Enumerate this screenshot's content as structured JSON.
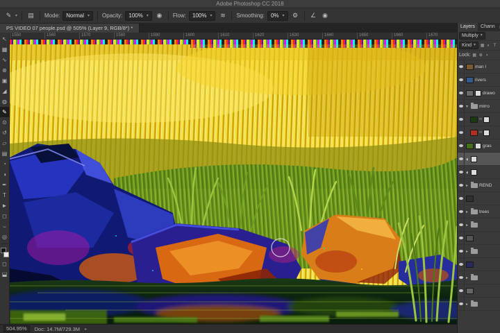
{
  "app": {
    "title": "Adobe Photoshop CC 2018"
  },
  "icons": {
    "chevron_down": "▾",
    "gear": "⚙",
    "pressure": "◉",
    "airbrush": "≋",
    "brush_preset": "✎",
    "brush_panel": "▤",
    "angle": "∠",
    "folder_arrow_open": "▾",
    "folder_arrow_closed": "▸",
    "link": "∞",
    "panel_menu": "»",
    "popup_arrow": "▸"
  },
  "options_bar": {
    "mode_label": "Mode:",
    "mode_value": "Normal",
    "opacity_label": "Opacity:",
    "opacity_value": "100%",
    "flow_label": "Flow:",
    "flow_value": "100%",
    "smoothing_label": "Smoothing:",
    "smoothing_value": "0%"
  },
  "document_tab": {
    "title": "PS VIDEO 07 people.psd @ 505% (Layer 9, RGB/8*) *"
  },
  "ruler": {
    "ticks": [
      "1550",
      "1560",
      "1570",
      "1580",
      "1590",
      "1600",
      "1610",
      "1620",
      "1630",
      "1640",
      "1650",
      "1660",
      "1670"
    ]
  },
  "toolbar": {
    "tools": [
      {
        "name": "move",
        "glyph": "↖"
      },
      {
        "name": "marquee",
        "glyph": "▦"
      },
      {
        "name": "lasso",
        "glyph": "∿"
      },
      {
        "name": "quick-selection",
        "glyph": "⊛"
      },
      {
        "name": "crop",
        "glyph": "▣"
      },
      {
        "name": "eyedropper",
        "glyph": "◢"
      },
      {
        "name": "spot-healing",
        "glyph": "◍"
      },
      {
        "name": "brush",
        "glyph": "✎"
      },
      {
        "name": "clone-stamp",
        "glyph": "⊙"
      },
      {
        "name": "history-brush",
        "glyph": "↺"
      },
      {
        "name": "eraser",
        "glyph": "▱"
      },
      {
        "name": "gradient",
        "glyph": "▤"
      },
      {
        "name": "blur",
        "glyph": "◔"
      },
      {
        "name": "dodge",
        "glyph": "◑"
      },
      {
        "name": "pen",
        "glyph": "✒"
      },
      {
        "name": "type",
        "glyph": "T"
      },
      {
        "name": "path-selection",
        "glyph": "►"
      },
      {
        "name": "shape",
        "glyph": "◻"
      },
      {
        "name": "hand",
        "glyph": "⌣"
      },
      {
        "name": "zoom",
        "glyph": "◎"
      }
    ]
  },
  "layers_panel": {
    "tabs": [
      {
        "label": "Layers"
      },
      {
        "label": "Chann"
      }
    ],
    "blend_mode": "Multiply",
    "filter_label": "Kind",
    "lock_label": "Lock:",
    "layers": [
      {
        "name": "man l"
      },
      {
        "name": "rivers"
      },
      {
        "name": "drawo"
      },
      {
        "name": "mirro"
      },
      {
        "name": ""
      },
      {
        "name": ""
      },
      {
        "name": "gras"
      },
      {
        "name": ""
      },
      {
        "name": ""
      },
      {
        "name": "REND"
      },
      {
        "name": ""
      },
      {
        "name": "trees"
      },
      {
        "name": ""
      },
      {
        "name": ""
      },
      {
        "name": ""
      },
      {
        "name": ""
      },
      {
        "name": ""
      },
      {
        "name": ""
      },
      {
        "name": ""
      }
    ]
  },
  "status_bar": {
    "zoom": "504.95%",
    "doc_info": "Doc: 14.7M/729.3M"
  }
}
